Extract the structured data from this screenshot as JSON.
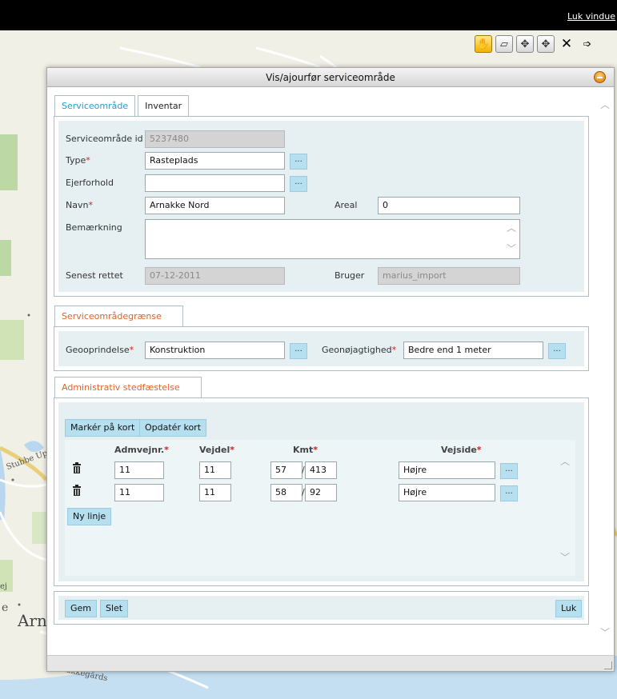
{
  "topbar": {
    "close_window_label": "Luk vindue"
  },
  "map": {
    "labels": {
      "road_left": "Stubbe Up Mos",
      "town": "Arn",
      "road_bottom": "Arnakkegårds",
      "left_e": "e",
      "left_ej": "ej"
    }
  },
  "toolbar": {
    "icons": [
      "pan-hand-icon",
      "select-area-icon",
      "move-icon",
      "move-vertex-icon",
      "close-x-icon",
      "select-arrow-icon"
    ]
  },
  "dialog": {
    "title": "Vis/ajourfør serviceområde",
    "tabs": [
      "Serviceområde",
      "Inventar"
    ],
    "service_area": {
      "id_label": "Serviceområde id",
      "id_value": "5237480",
      "type_label": "Type",
      "type_value": "Rasteplads",
      "ownership_label": "Ejerforhold",
      "ownership_value": "",
      "name_label": "Navn",
      "name_value": "Arnakke Nord",
      "area_label": "Areal",
      "area_value": "0",
      "remark_label": "Bemærkning",
      "remark_value": "",
      "last_edited_label": "Senest rettet",
      "last_edited_value": "07-12-2011",
      "user_label": "Bruger",
      "user_value": "marius_import"
    },
    "boundary": {
      "tab_label": "Serviceområdegrænse",
      "geo_origin_label": "Geooprindelse",
      "geo_origin_value": "Konstruktion",
      "geo_accuracy_label": "Geonøjagtighed",
      "geo_accuracy_value": "Bedre end 1 meter"
    },
    "admin": {
      "tab_label": "Administrativ stedfæstelse",
      "mark_on_map_label": "Markér på kort",
      "update_map_label": "Opdatér kort",
      "columns": {
        "road_no": "Admvejnr.",
        "road_part": "Vejdel",
        "km": "Kmt",
        "side": "Vejside"
      },
      "rows": [
        {
          "road_no": "11",
          "road_part": "11",
          "km": "57",
          "m": "413",
          "side": "Højre"
        },
        {
          "road_no": "11",
          "road_part": "11",
          "km": "58",
          "m": "92",
          "side": "Højre"
        }
      ],
      "new_line_label": "Ny linje"
    },
    "buttons": {
      "save": "Gem",
      "delete": "Slet",
      "close": "Luk",
      "lookup": "..."
    },
    "required_mark": "*",
    "slash": "/"
  }
}
